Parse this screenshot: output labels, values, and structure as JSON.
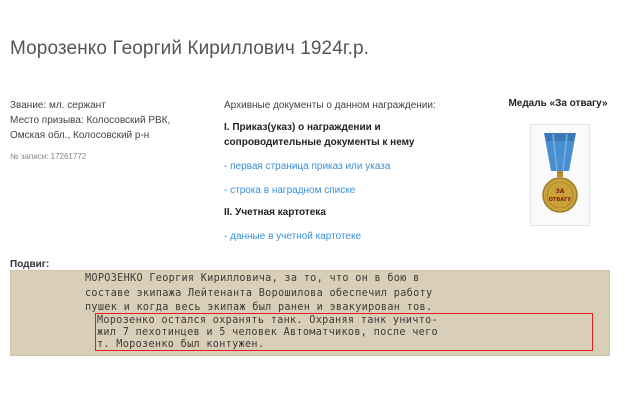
{
  "person": {
    "name": "Морозенко Георгий Кириллович 1924г.р.",
    "rank": "Звание: мл. сержант",
    "draft_line1": "Место призыва: Колосовский РВК,",
    "draft_line2": "Омская обл., Колосовский р-н",
    "record_no": "№ записи: 17261772"
  },
  "archive": {
    "heading": "Архивные документы о данном награждении:",
    "section1_line1": "I. Приказ(указ) о награждении и",
    "section1_line2": "сопроводительные документы к нему",
    "link1": "- первая страница приказ или указа",
    "link2": "- строка в наградном списке",
    "section2": "II. Учетная картотека",
    "link3": "- данные в учетной картотеке"
  },
  "medal": {
    "title": "Медаль «За отвагу»",
    "ribbon_color": "#4a8fcf",
    "medal_color": "#c9a23a",
    "inscription_top": "ЗА",
    "inscription_bottom": "ОТВАГУ"
  },
  "feat": {
    "label": "Подвиг:",
    "lines": [
      "МОРОЗЕНКО Георгия Кирилловича, за то, что он в бою в",
      "составе экипажа Лейтенанта Ворошилова обеспечил работу",
      "пушек и когда весь экипаж был ранен и эвакуирован тов.",
      "Морозенко остался охранять танк. Охраняя танк уничто-",
      "жил 7 пехотинцев и 5 человек Автоматчиков, после чего",
      "т. Морозенко был контужен."
    ],
    "highlight_color": "#e02020"
  }
}
